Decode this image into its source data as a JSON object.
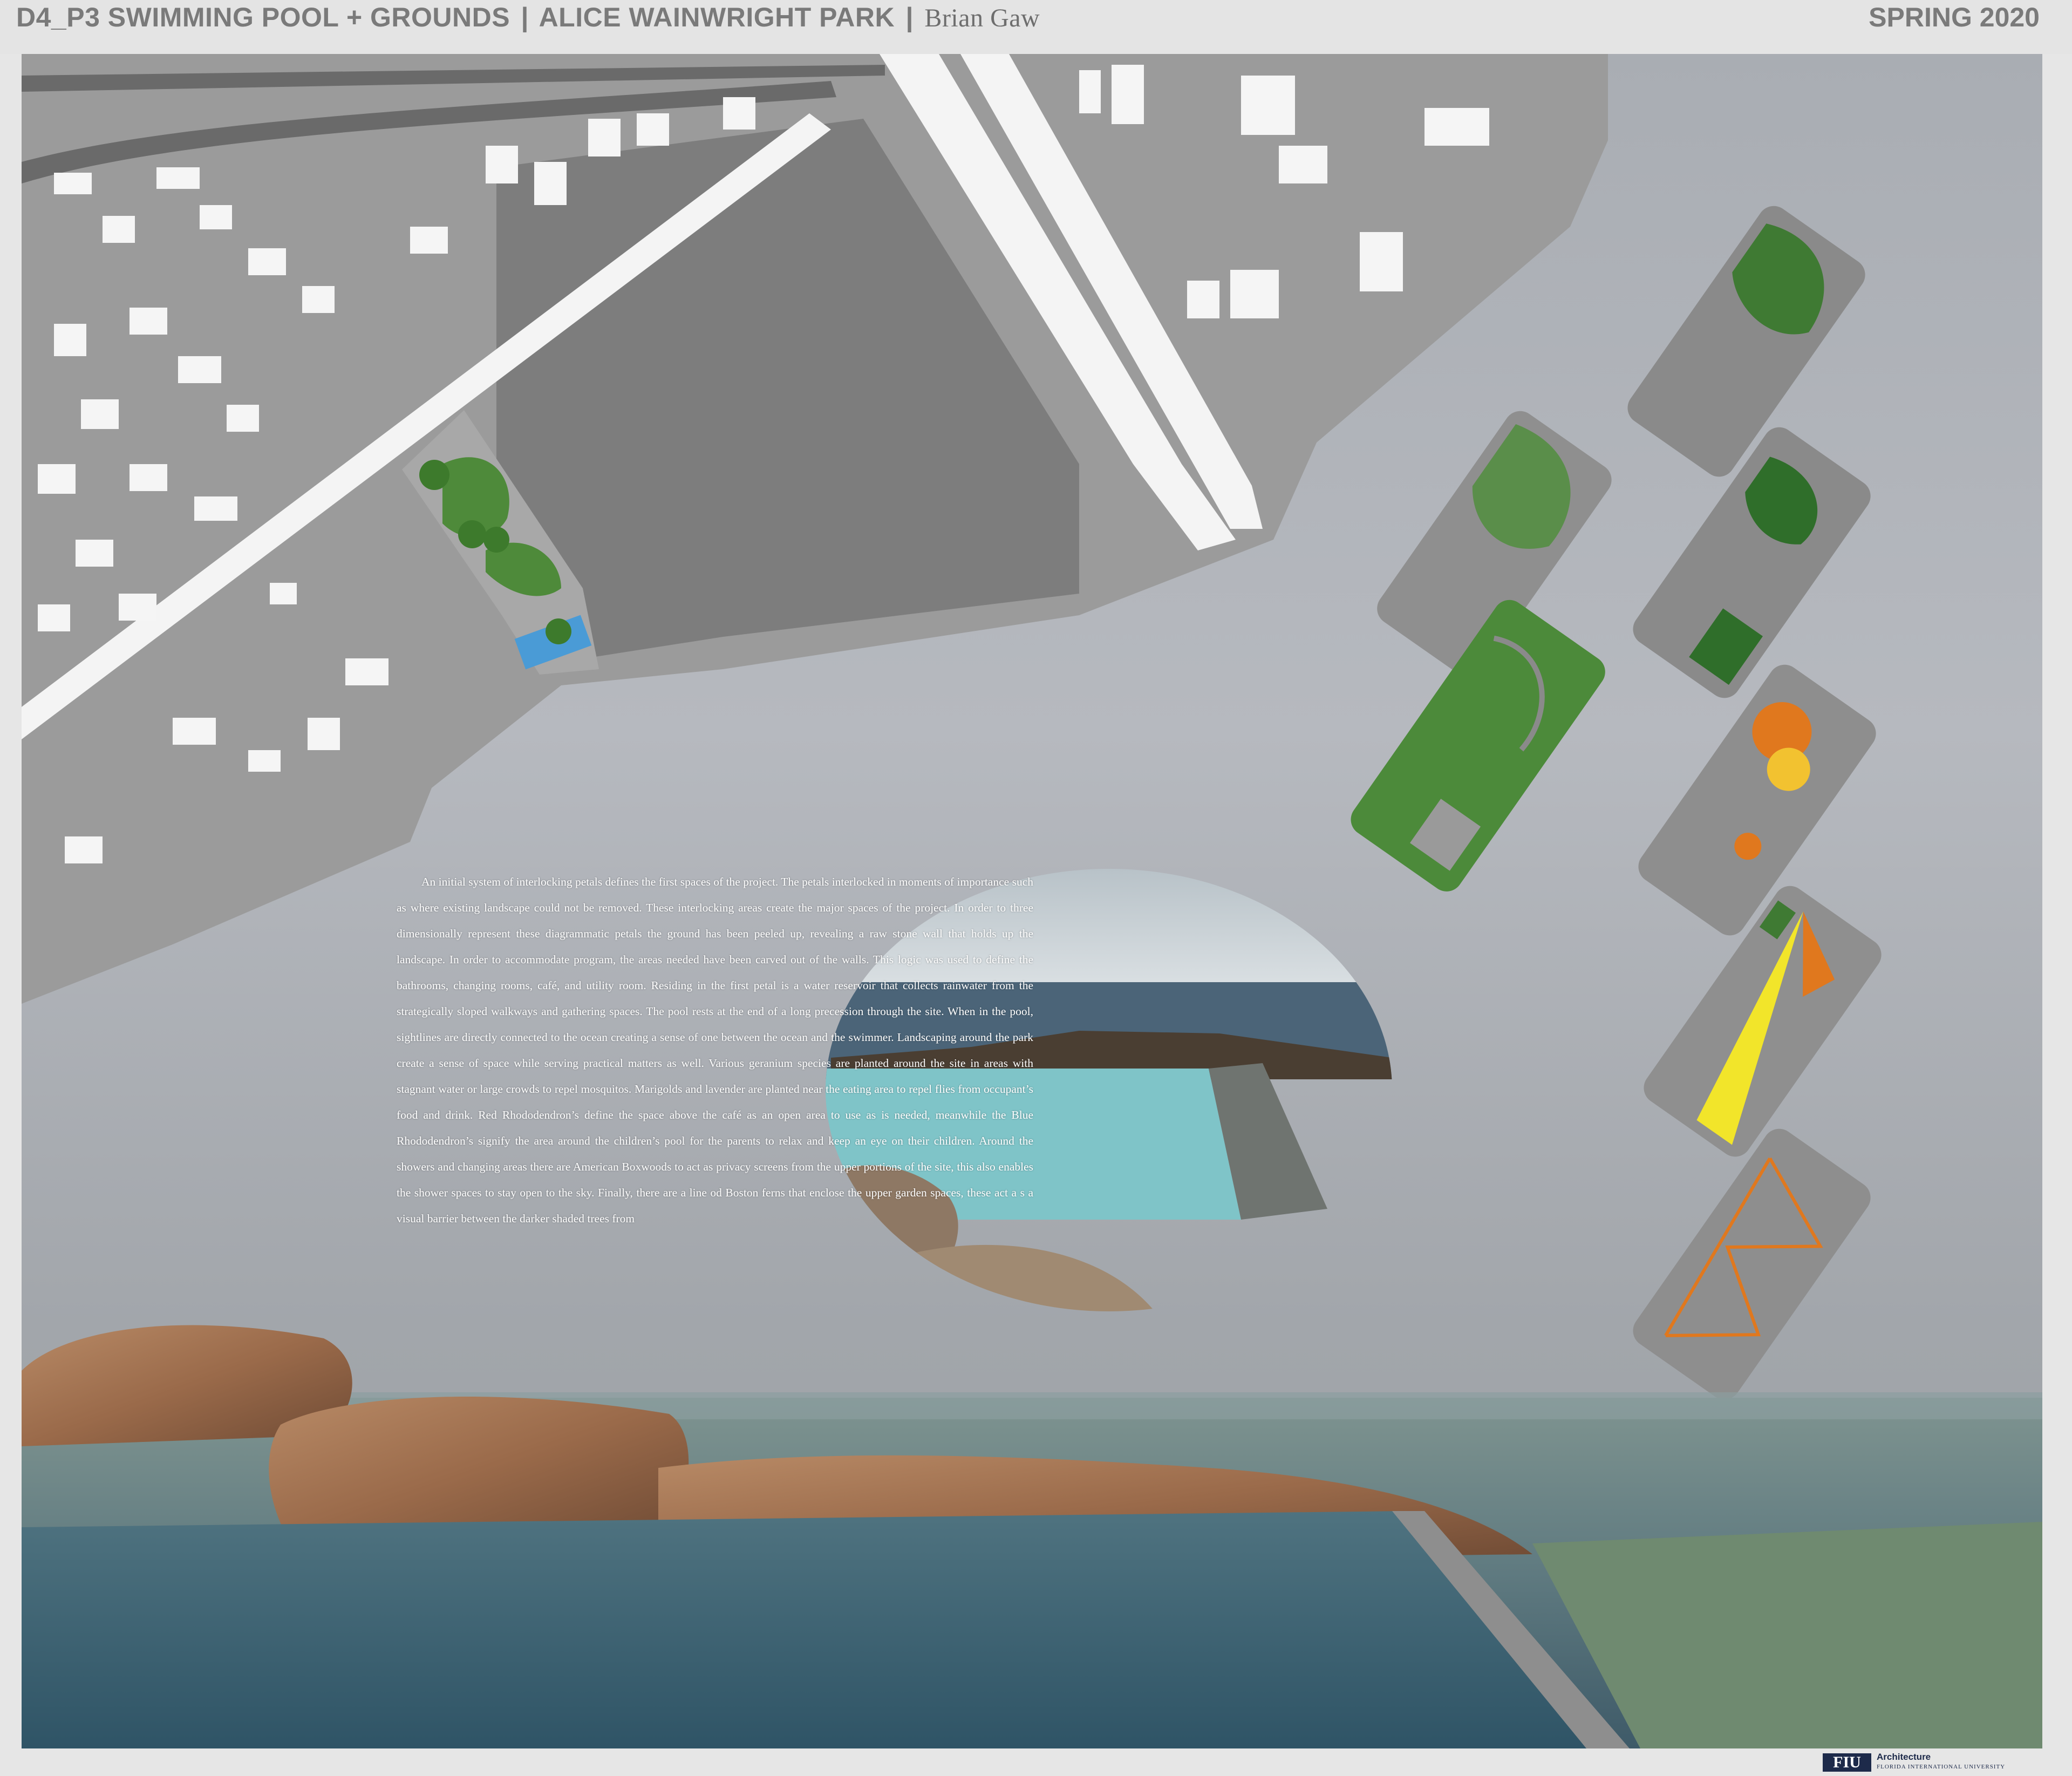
{
  "header": {
    "title_part1": "D4_P3 SWIMMING POOL + GROUNDS",
    "separator": "|",
    "title_part2": "ALICE WAINWRIGHT PARK",
    "author": "Brian Gaw",
    "semester": "SPRING 2020"
  },
  "description": "An initial system of interlocking petals defines the first spaces of the project. The petals interlocked in moments of importance such as where existing landscape could not be removed. These interlocking areas create the major spaces of the project. In order to three dimensionally represent these diagrammatic petals the ground has been peeled up, revealing a raw stone wall that holds up the landscape. In order to accommodate program, the areas needed have been carved out of the walls. This logic was used to define the bathrooms, changing rooms, café, and utility room. Residing in the first petal is a water reservoir that collects rainwater from the strategically sloped walkways and gathering spaces. The pool rests at the end of a long precession through the site. When in the pool, sightlines are directly connected to the ocean creating a sense of one between the ocean and the swimmer. Landscaping around the park create a sense of space while serving practical matters as well. Various geranium species are planted around the site in areas with stagnant water or large crowds to repel mosquitos. Marigolds and lavender are planted near the eating area to repel flies from occupant’s food and drink. Red Rhododendron’s define the space above the café as an open area to use as is needed, meanwhile the Blue Rhododendron’s signify the area around the children’s pool for the parents to relax and keep an eye on their children. Around the showers and changing areas there are American Boxwoods to act as privacy screens from the upper portions of the site, this also enables the shower spaces to stay open to the sky. Finally, there are a line od Boston ferns that enclose the upper garden spaces, these act a s a visual barrier between the darker shaded trees from",
  "footer": {
    "logo_mark": "FIU",
    "department": "Architecture",
    "university": "FLORIDA INTERNATIONAL UNIVERSITY"
  },
  "colors": {
    "header_text": "#7a7a7a",
    "site_plan": "#9c9c9c",
    "lawn_green": "#4e8a3a",
    "pool_water": "#7fc4c8",
    "ocean": "#5f7a80",
    "rock": "#a5785a",
    "diagram_orange": "#e0781e",
    "diagram_yellow": "#f2e52a"
  },
  "icons": {
    "logo": "fiu-logo-mark"
  }
}
